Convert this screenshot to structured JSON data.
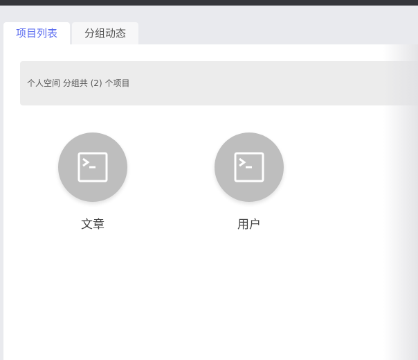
{
  "tabs": [
    {
      "label": "项目列表",
      "active": true
    },
    {
      "label": "分组动态",
      "active": false
    }
  ],
  "banner": {
    "text": "个人空间 分组共 (2) 个项目"
  },
  "projects": [
    {
      "name": "文章",
      "icon": "terminal-icon"
    },
    {
      "name": "用户",
      "icon": "terminal-icon"
    }
  ],
  "colors": {
    "accent": "#5b6cf0",
    "icon_bg": "#bebebe"
  }
}
